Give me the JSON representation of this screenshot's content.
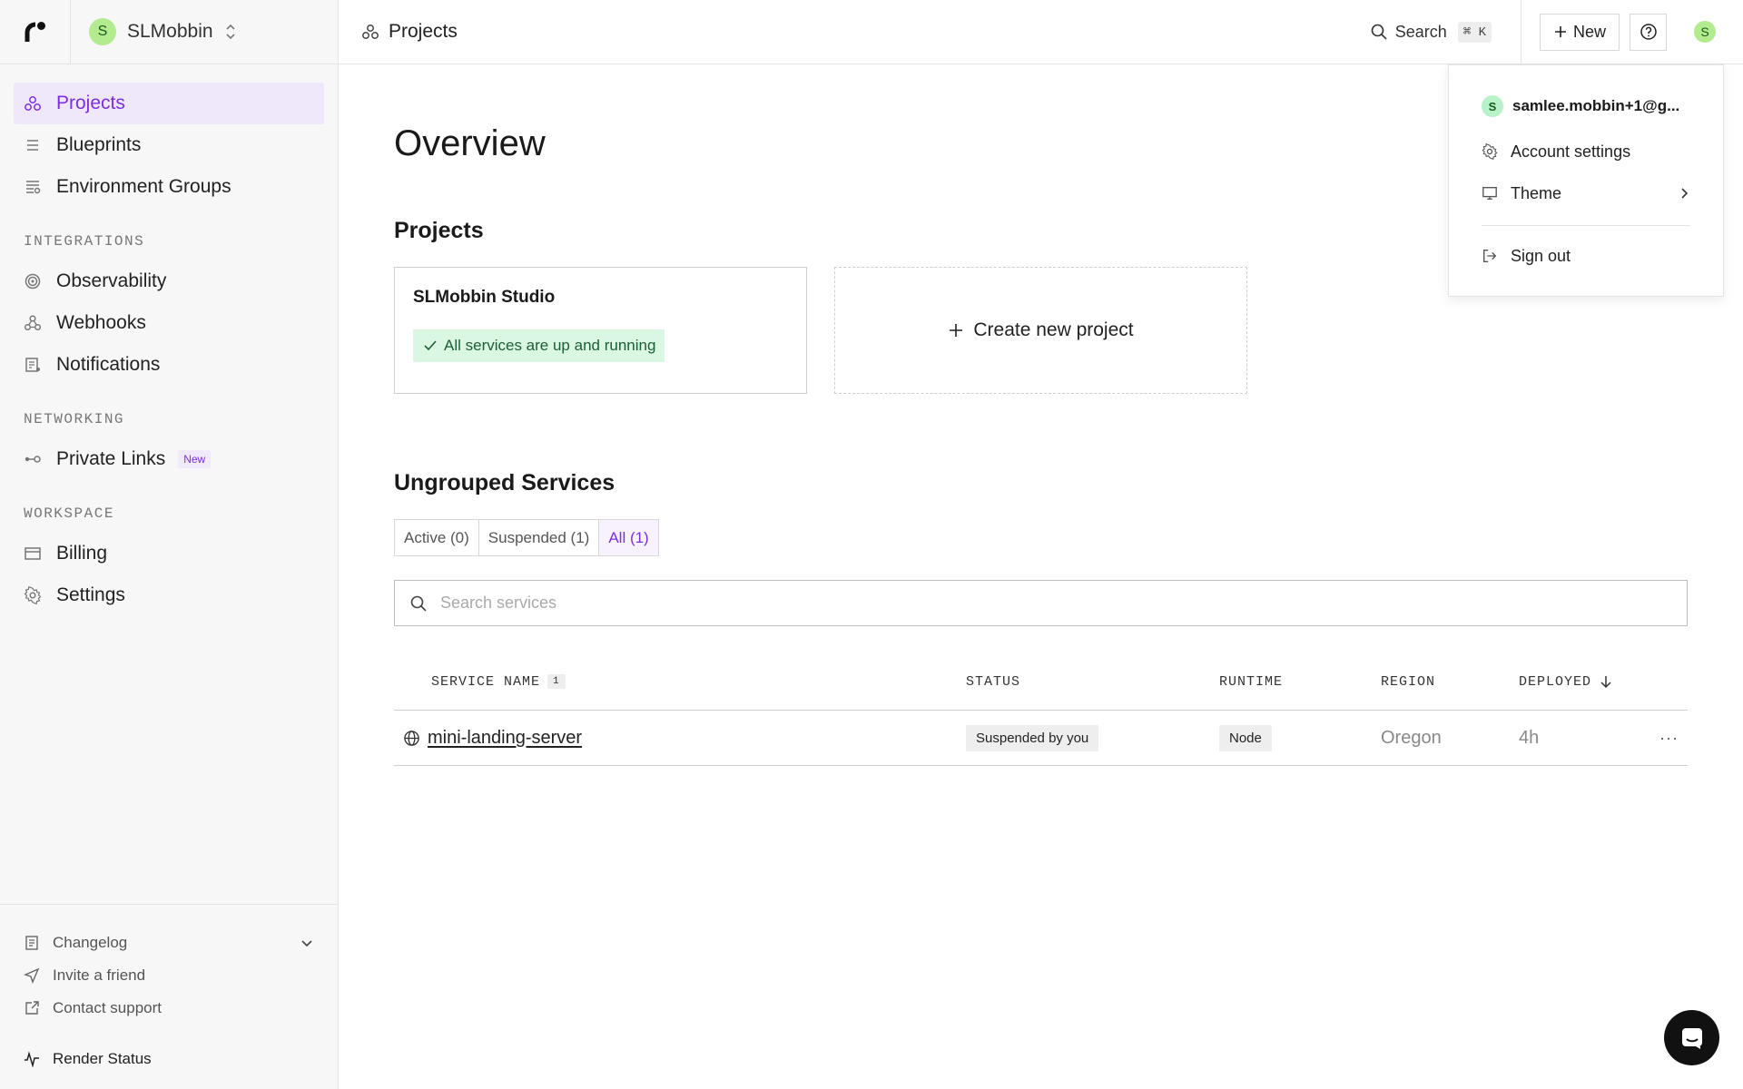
{
  "sidebar": {
    "workspace_initial": "S",
    "workspace_name": "SLMobbin",
    "nav": [
      {
        "label": "Projects",
        "icon": "projects-icon",
        "active": true
      },
      {
        "label": "Blueprints",
        "icon": "blueprints-icon"
      },
      {
        "label": "Environment Groups",
        "icon": "environment-groups-icon"
      }
    ],
    "sections": {
      "integrations": "INTEGRATIONS",
      "networking": "NETWORKING",
      "workspace": "WORKSPACE"
    },
    "integrations": [
      {
        "label": "Observability",
        "icon": "observability-icon"
      },
      {
        "label": "Webhooks",
        "icon": "webhooks-icon"
      },
      {
        "label": "Notifications",
        "icon": "notifications-icon"
      }
    ],
    "networking": [
      {
        "label": "Private Links",
        "badge": "New",
        "icon": "private-links-icon"
      }
    ],
    "workspace": [
      {
        "label": "Billing",
        "icon": "billing-icon"
      },
      {
        "label": "Settings",
        "icon": "settings-icon"
      }
    ],
    "bottom": {
      "changelog": "Changelog",
      "invite": "Invite a friend",
      "support": "Contact support",
      "status": "Render Status"
    }
  },
  "topbar": {
    "breadcrumb": "Projects",
    "search_label": "Search",
    "search_shortcut": "⌘ K",
    "new_label": "New",
    "avatar_initial": "S"
  },
  "main": {
    "title": "Overview",
    "projects_heading": "Projects",
    "project_card": {
      "name": "SLMobbin Studio",
      "status": "All services are up and running"
    },
    "create_project_label": "Create new project",
    "ungrouped_heading": "Ungrouped Services",
    "tabs": [
      "Active (0)",
      "Suspended (1)",
      "All (1)"
    ],
    "active_tab": 2,
    "search_placeholder": "Search services",
    "table": {
      "headers": {
        "name": "SERVICE NAME",
        "name_count": "1",
        "status": "STATUS",
        "runtime": "RUNTIME",
        "region": "REGION",
        "deployed": "DEPLOYED"
      },
      "rows": [
        {
          "name": "mini-landing-server",
          "status": "Suspended by you",
          "runtime": "Node",
          "region": "Oregon",
          "deployed": "4h"
        }
      ]
    }
  },
  "user_menu": {
    "email": "samlee.mobbin+1@g...",
    "initial": "S",
    "account_settings": "Account settings",
    "theme": "Theme",
    "sign_out": "Sign out"
  },
  "colors": {
    "accent": "#7c2fe0",
    "avatar_green": "#b3eb8f",
    "status_green_bg": "#d9f7e2"
  }
}
